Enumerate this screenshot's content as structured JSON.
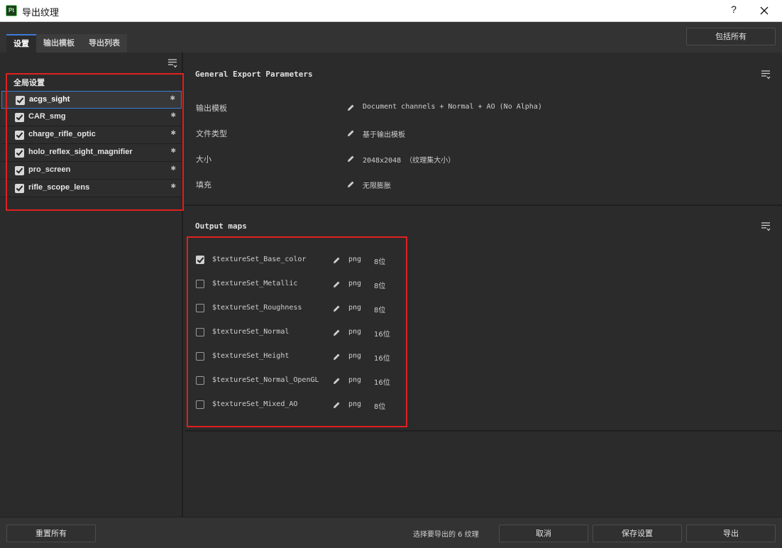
{
  "window": {
    "app_icon_text": "Pt",
    "title": "导出纹理",
    "help_label": "?"
  },
  "tabs": [
    {
      "label": "设置",
      "active": true
    },
    {
      "label": "输出模板",
      "active": false
    },
    {
      "label": "导出列表",
      "active": false
    }
  ],
  "top": {
    "include_all_label": "包括所有"
  },
  "left": {
    "global_settings_label": "全局设置",
    "texture_sets": [
      {
        "name": "acgs_sight",
        "checked": true,
        "selected": true,
        "star": "✱"
      },
      {
        "name": "CAR_smg",
        "checked": true,
        "selected": false,
        "star": "✱"
      },
      {
        "name": "charge_rifle_optic",
        "checked": true,
        "selected": false,
        "star": "✱"
      },
      {
        "name": "holo_reflex_sight_magnifier",
        "checked": true,
        "selected": false,
        "star": "✱"
      },
      {
        "name": "pro_screen",
        "checked": true,
        "selected": false,
        "star": "✱"
      },
      {
        "name": "rifle_scope_lens",
        "checked": true,
        "selected": false,
        "star": "✱"
      }
    ]
  },
  "general": {
    "title": "General Export Parameters",
    "params": [
      {
        "label": "输出模板",
        "value": "Document channels + Normal + AO (No Alpha)"
      },
      {
        "label": "文件类型",
        "value": "基于输出模板"
      },
      {
        "label": "大小",
        "value": "2048x2048 （纹理集大小）"
      },
      {
        "label": "填充",
        "value": "无限膨胀"
      }
    ]
  },
  "output_maps": {
    "title": "Output maps",
    "maps": [
      {
        "name": "$textureSet_Base_color",
        "checked": true,
        "format": "png",
        "bits": "8位"
      },
      {
        "name": "$textureSet_Metallic",
        "checked": false,
        "format": "png",
        "bits": "8位"
      },
      {
        "name": "$textureSet_Roughness",
        "checked": false,
        "format": "png",
        "bits": "8位"
      },
      {
        "name": "$textureSet_Normal",
        "checked": false,
        "format": "png",
        "bits": "16位"
      },
      {
        "name": "$textureSet_Height",
        "checked": false,
        "format": "png",
        "bits": "16位"
      },
      {
        "name": "$textureSet_Normal_OpenGL",
        "checked": false,
        "format": "png",
        "bits": "16位"
      },
      {
        "name": "$textureSet_Mixed_AO",
        "checked": false,
        "format": "png",
        "bits": "8位"
      }
    ]
  },
  "bottom": {
    "reset_all_label": "重置所有",
    "status": "选择要导出的 6 纹理",
    "cancel_label": "取消",
    "save_settings_label": "保存设置",
    "export_label": "导出"
  },
  "colors": {
    "highlight_box": "#e02020",
    "selection_accent": "#3d7bd6",
    "background": "#2b2b2b"
  }
}
